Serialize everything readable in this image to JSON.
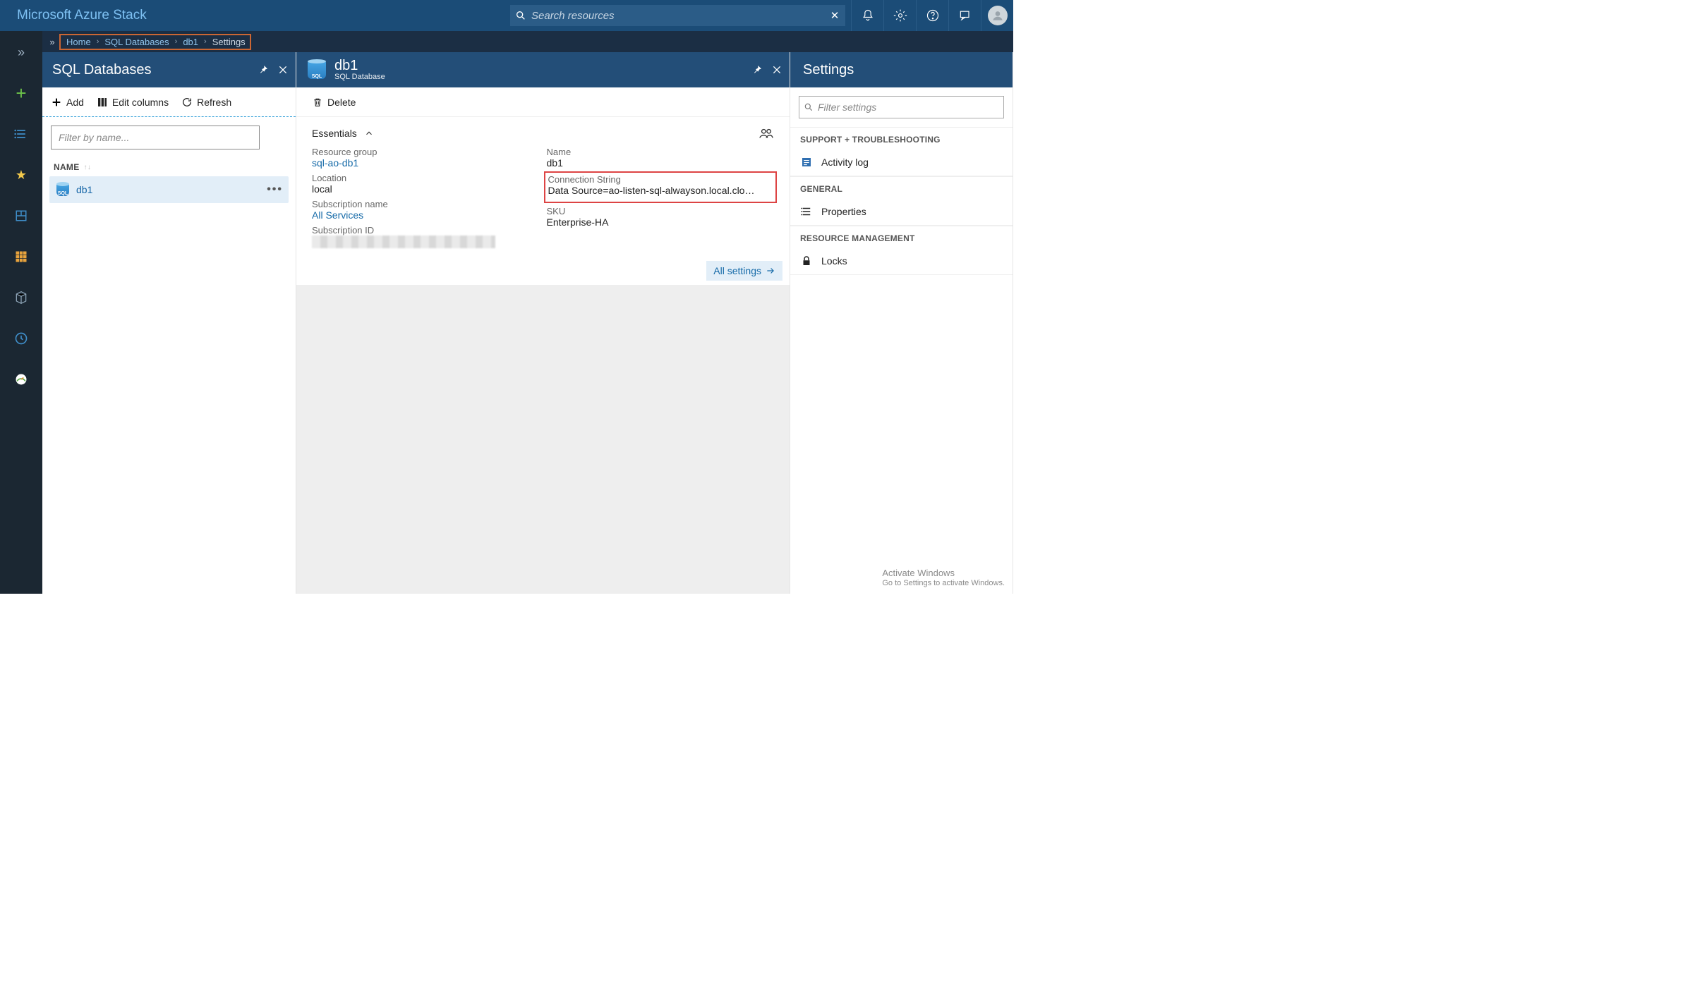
{
  "brand": "Microsoft Azure Stack",
  "search": {
    "placeholder": "Search resources"
  },
  "breadcrumb": {
    "items": [
      "Home",
      "SQL Databases",
      "db1",
      "Settings"
    ]
  },
  "blade1": {
    "title": "SQL Databases",
    "toolbar": {
      "add": "Add",
      "edit_columns": "Edit columns",
      "refresh": "Refresh"
    },
    "filter_placeholder": "Filter by name...",
    "column_header": "NAME",
    "rows": [
      {
        "name": "db1"
      }
    ]
  },
  "blade2": {
    "title": "db1",
    "subtitle": "SQL Database",
    "toolbar": {
      "delete": "Delete"
    },
    "essentials_label": "Essentials",
    "all_settings": "All settings",
    "fields": {
      "resource_group_label": "Resource group",
      "resource_group": "sql-ao-db1",
      "name_label": "Name",
      "name": "db1",
      "location_label": "Location",
      "location": "local",
      "connection_label": "Connection String",
      "connection": "Data Source=ao-listen-sql-alwayson.local.clo…",
      "subscription_name_label": "Subscription name",
      "subscription_name": "All Services",
      "sku_label": "SKU",
      "sku": "Enterprise-HA",
      "subscription_id_label": "Subscription ID"
    }
  },
  "blade3": {
    "title": "Settings",
    "filter_placeholder": "Filter settings",
    "sections": {
      "support": "SUPPORT + TROUBLESHOOTING",
      "general": "GENERAL",
      "resource": "RESOURCE MANAGEMENT"
    },
    "items": {
      "activity_log": "Activity log",
      "properties": "Properties",
      "locks": "Locks"
    }
  },
  "watermark": {
    "t1": "Activate Windows",
    "t2": "Go to Settings to activate Windows."
  }
}
